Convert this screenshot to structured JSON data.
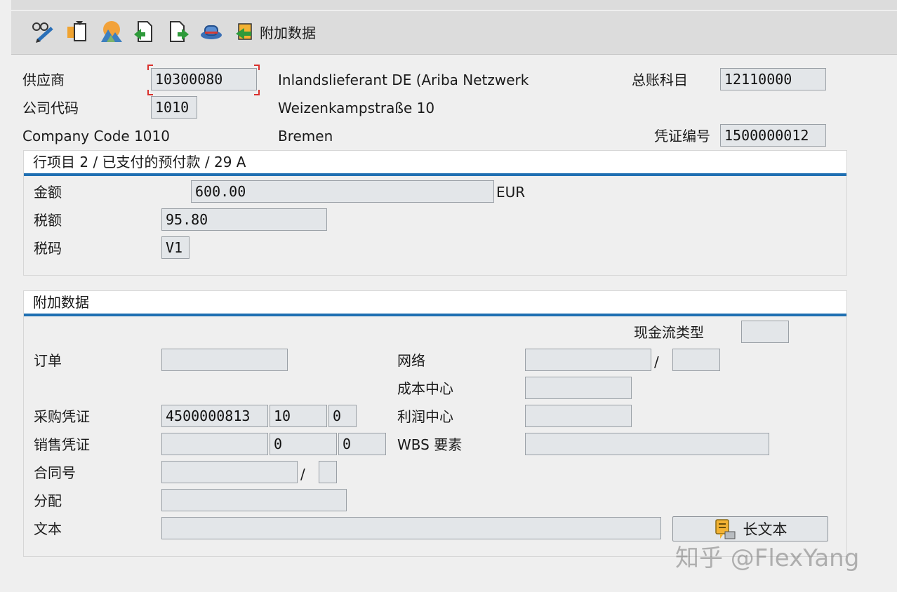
{
  "toolbar": {
    "icons": [
      "glasses-edit-icon",
      "copy-document-icon",
      "mountain-image-icon",
      "document-back-icon",
      "document-forward-icon",
      "hat-icon"
    ],
    "additional_data_label": "附加数据"
  },
  "header": {
    "vendor_label": "供应商",
    "vendor_value": "10300080",
    "vendor_name": "Inlandslieferant DE (Ariba Netzwerk",
    "gl_account_label": "总账科目",
    "gl_account_value": "12110000",
    "company_code_label": "公司代码",
    "company_code_value": "1010",
    "street": "Weizenkampstraße 10",
    "company_code_text": "Company Code 1010",
    "city": "Bremen",
    "doc_number_label": "凭证编号",
    "doc_number_value": "1500000012"
  },
  "line_item": {
    "title": "行项目 2 / 已支付的预付款 / 29 A",
    "amount_label": "金额",
    "amount_value": "600.00",
    "currency": "EUR",
    "tax_amount_label": "税额",
    "tax_amount_value": "95.80",
    "tax_code_label": "税码",
    "tax_code_value": "V1"
  },
  "additional": {
    "title": "附加数据",
    "cash_flow_type_label": "现金流类型",
    "cash_flow_type_value": "",
    "order_label": "订单",
    "order_value": "",
    "network_label": "网络",
    "network_value": "",
    "network_sep": "/",
    "network_activity_value": "",
    "cost_center_label": "成本中心",
    "cost_center_value": "",
    "purchasing_doc_label": "采购凭证",
    "purchasing_doc_value": "4500000813",
    "purchasing_item_value": "10",
    "purchasing_sched_value": "0",
    "profit_center_label": "利润中心",
    "profit_center_value": "",
    "sales_doc_label": "销售凭证",
    "sales_doc_value": "",
    "sales_item_value": "0",
    "sales_sched_value": "0",
    "wbs_label": "WBS 要素",
    "wbs_value": "",
    "contract_label": "合同号",
    "contract_value": "",
    "contract_sep": "/",
    "contract_type_value": "",
    "assignment_label": "分配",
    "assignment_value": "",
    "text_label": "文本",
    "text_value": "",
    "long_text_button": "长文本"
  },
  "watermark": "知乎 @FlexYang",
  "colors": {
    "toolbar_bg": "#dcdcdc",
    "field_bg": "#e3e6e9",
    "panel_underline": "#1f6fb2",
    "focus_bracket": "#d9302c"
  }
}
